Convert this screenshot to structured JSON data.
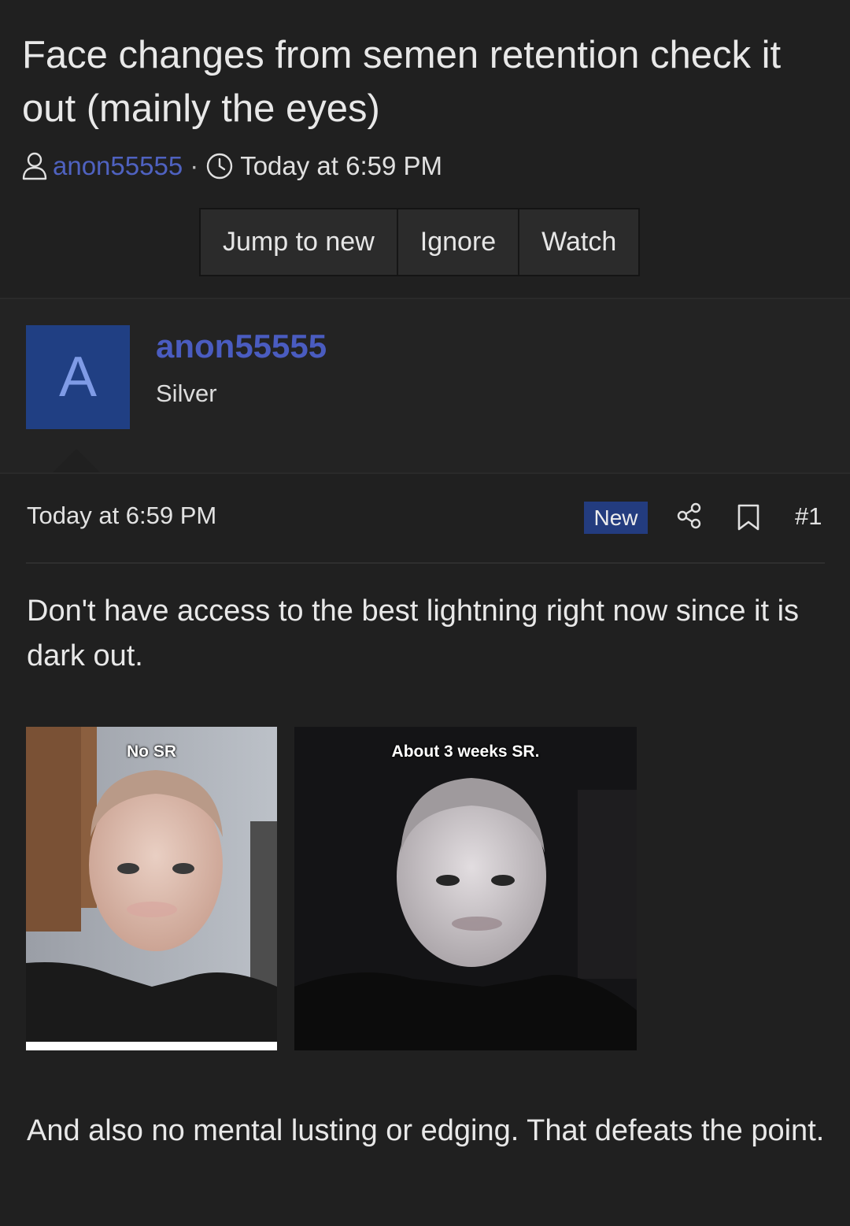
{
  "thread": {
    "title": "Face changes from semen retention check it out (mainly the eyes)",
    "author": "anon55555",
    "separator": "·",
    "date": "Today at 6:59 PM"
  },
  "actions": {
    "jump_to_new": "Jump to new",
    "ignore": "Ignore",
    "watch": "Watch"
  },
  "post": {
    "user": {
      "avatar_letter": "A",
      "name": "anon55555",
      "title": "Silver"
    },
    "date": "Today at 6:59 PM",
    "badge": "New",
    "number": "#1",
    "text1": "Don't have access to the best lightning right now since it is dark out.",
    "images": [
      {
        "caption": "No SR"
      },
      {
        "caption": "About 3 weeks SR."
      }
    ],
    "text2": "And also no mental lusting or edging. That defeats the point."
  },
  "colors": {
    "background": "#202020",
    "link": "#4a5cc0",
    "avatar_bg": "#203f83",
    "badge_bg": "#233c7f"
  },
  "icons": {
    "user": "user-icon",
    "clock": "clock-icon",
    "share": "share-icon",
    "bookmark": "bookmark-icon"
  }
}
